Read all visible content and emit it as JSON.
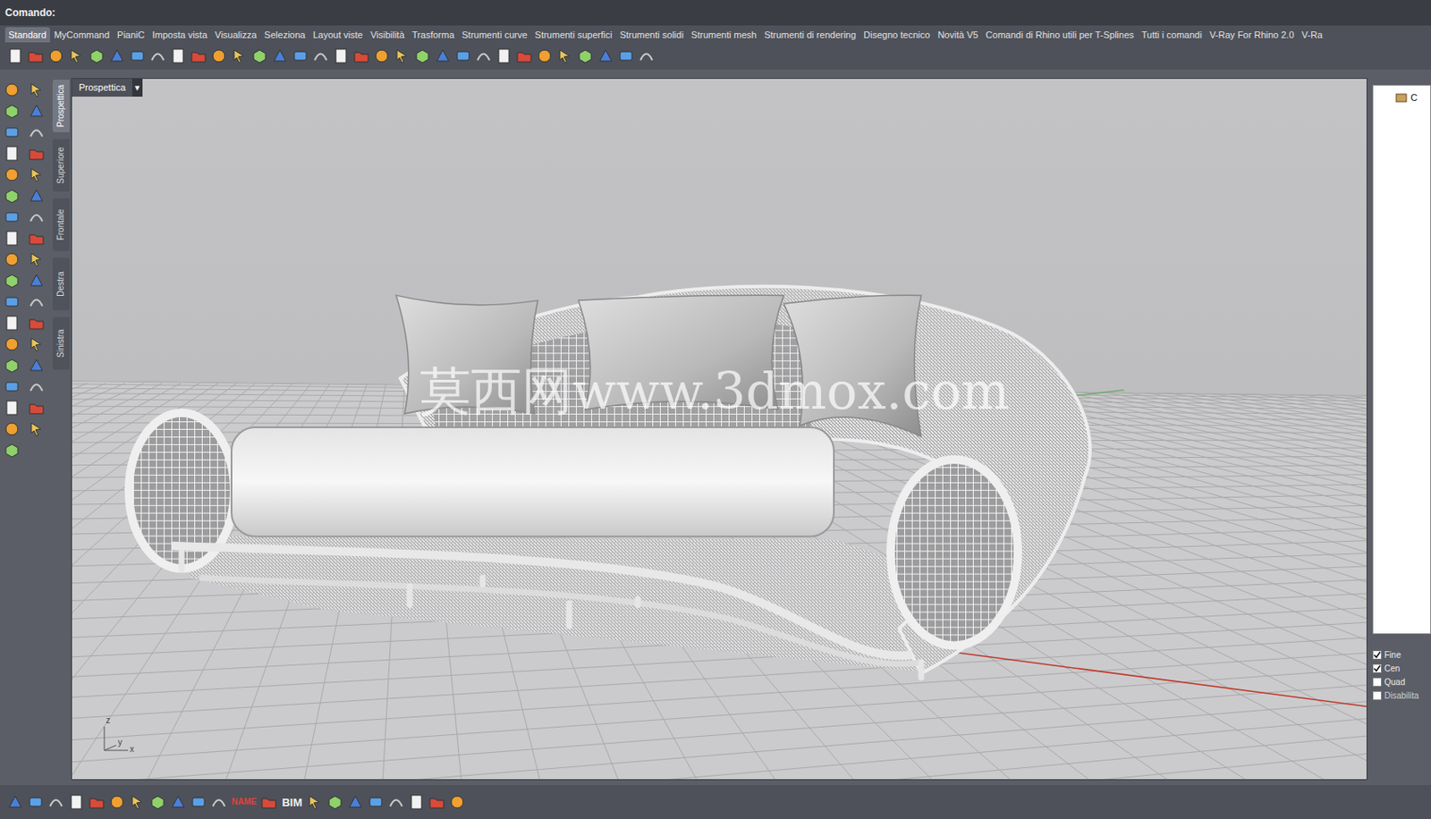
{
  "command_line": {
    "label": "Comando:"
  },
  "tabs": [
    {
      "label": "Standard",
      "selected": true
    },
    {
      "label": "MyCommand",
      "selected": false
    },
    {
      "label": "PianiC",
      "selected": false
    },
    {
      "label": "Imposta vista",
      "selected": false
    },
    {
      "label": "Visualizza",
      "selected": false
    },
    {
      "label": "Seleziona",
      "selected": false
    },
    {
      "label": "Layout viste",
      "selected": false
    },
    {
      "label": "Visibilità",
      "selected": false
    },
    {
      "label": "Trasforma",
      "selected": false
    },
    {
      "label": "Strumenti curve",
      "selected": false
    },
    {
      "label": "Strumenti superfici",
      "selected": false
    },
    {
      "label": "Strumenti solidi",
      "selected": false
    },
    {
      "label": "Strumenti mesh",
      "selected": false
    },
    {
      "label": "Strumenti di rendering",
      "selected": false
    },
    {
      "label": "Disegno tecnico",
      "selected": false
    },
    {
      "label": "Novità V5",
      "selected": false
    },
    {
      "label": "Comandi di Rhino utili per T-Splines",
      "selected": false
    },
    {
      "label": "Tutti i comandi",
      "selected": false
    },
    {
      "label": "V-Ray For Rhino 2.0",
      "selected": false
    },
    {
      "label": "V-Ra",
      "selected": false
    }
  ],
  "viewport_tabs": [
    {
      "label": "Prospettica",
      "selected": true
    },
    {
      "label": "Superiore",
      "selected": false
    },
    {
      "label": "Frontale",
      "selected": false
    },
    {
      "label": "Destra",
      "selected": false
    },
    {
      "label": "Sinistra",
      "selected": false
    }
  ],
  "viewport": {
    "title": "Prospettica",
    "dropdown": "▾",
    "watermark": "莫西网www.3dmox.com",
    "axes": [
      "z",
      "y",
      "x"
    ]
  },
  "layers": {
    "items": [
      "C"
    ]
  },
  "osnap": [
    {
      "label": "Fine",
      "checked": true
    },
    {
      "label": "Cen",
      "checked": true
    },
    {
      "label": "Quad",
      "checked": false
    },
    {
      "label": "Disabilita",
      "checked": false
    }
  ],
  "bottom_toolbar": [
    {
      "kind": "icon"
    },
    {
      "kind": "icon"
    },
    {
      "kind": "icon"
    },
    {
      "kind": "icon"
    },
    {
      "kind": "icon"
    },
    {
      "kind": "icon"
    },
    {
      "kind": "icon"
    },
    {
      "kind": "icon"
    },
    {
      "kind": "icon"
    },
    {
      "kind": "icon"
    },
    {
      "kind": "icon"
    },
    {
      "kind": "label",
      "text": "NAME"
    },
    {
      "kind": "icon"
    },
    {
      "kind": "label",
      "text": "BIM"
    },
    {
      "kind": "icon"
    },
    {
      "kind": "icon"
    },
    {
      "kind": "icon"
    },
    {
      "kind": "icon"
    },
    {
      "kind": "icon"
    },
    {
      "kind": "icon"
    },
    {
      "kind": "icon"
    },
    {
      "kind": "icon"
    }
  ]
}
